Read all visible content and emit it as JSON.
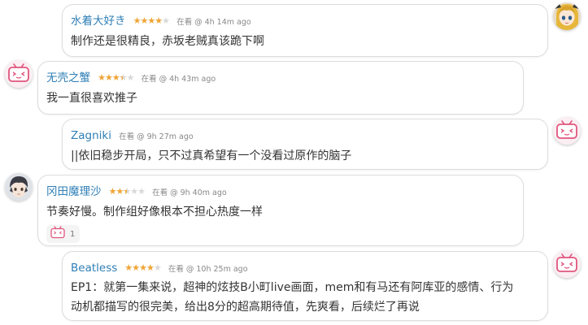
{
  "comments": [
    {
      "user": "水着大好き",
      "rating": 4,
      "status": "在看 @ 4h 14m ago",
      "text": "制作还是很精良，赤坂老贼真该跪下啊"
    },
    {
      "user": "无壳之蟹",
      "rating": 3.5,
      "status": "在看 @ 4h 43m ago",
      "text": "我一直很喜欢推子"
    },
    {
      "user": "Zagniki",
      "status": "在看 @ 9h 27m ago",
      "text": "||依旧稳步开局，只不过真希望有一个没看过原作的脑子"
    },
    {
      "user": "冈田魔理沙",
      "rating": 2.5,
      "status": "在看 @ 9h 40m ago",
      "text": "节奏好慢。制作组好像根本不担心热度一样",
      "likes": "1"
    },
    {
      "user": "Beatless",
      "rating": 4,
      "status": "在看 @ 10h 25m ago",
      "text_lines": [
        "EP1：就第一集来说，超神的炫技B小町live画面，mem和有马还有阿库亚的感情、行为",
        "动机都描写的很完美，给出8分的超高期待值，先爽看，后续烂了再说"
      ]
    }
  ],
  "colors": {
    "username": "#2f7fb6",
    "star_on": "#f0a435",
    "star_off": "#d8d8d8",
    "status": "#888888",
    "border": "#dcdcdc"
  },
  "icons": [
    "anime-girl-avatar",
    "bilibili-tv-avatar",
    "anime-boy-avatar",
    "like-icon"
  ]
}
